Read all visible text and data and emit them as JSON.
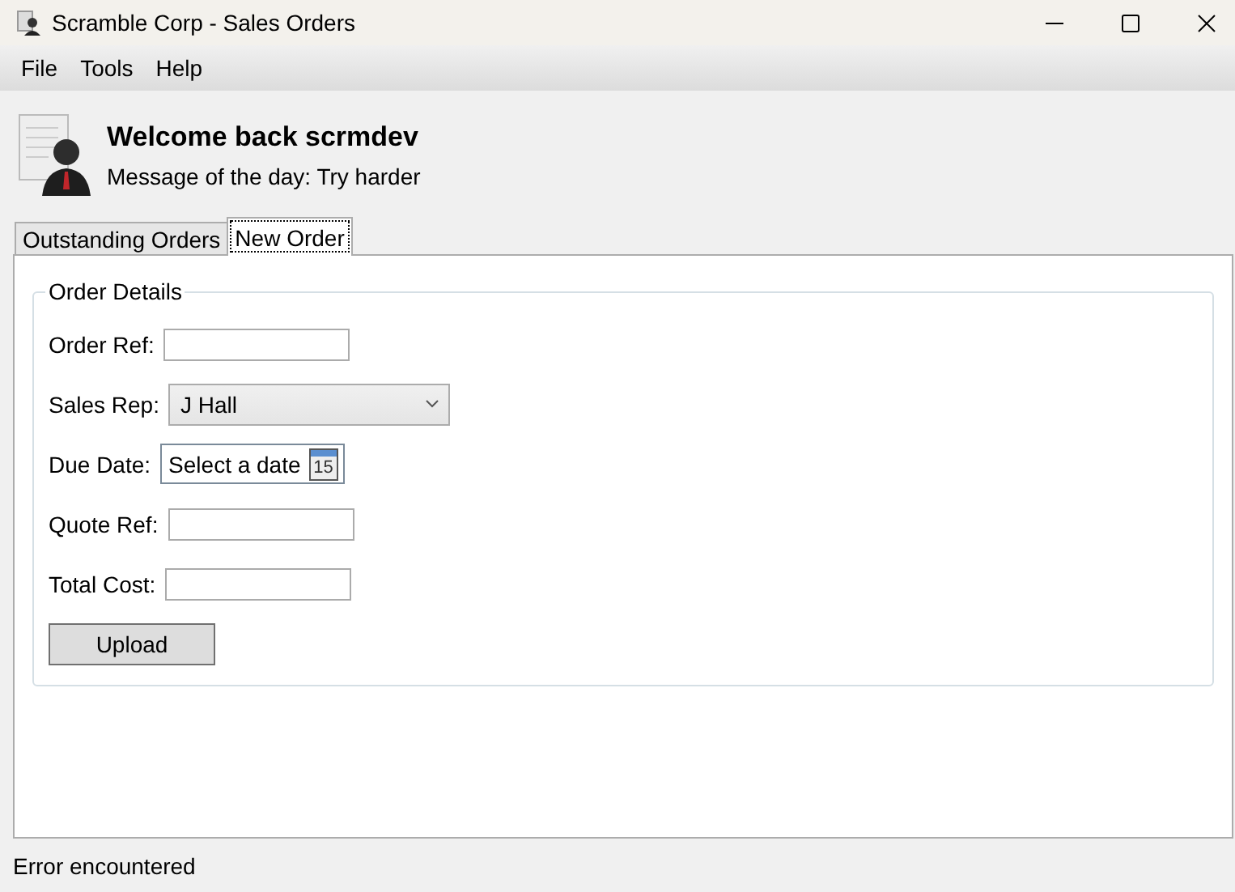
{
  "window": {
    "title": "Scramble Corp - Sales Orders"
  },
  "menu": [
    {
      "label": "File"
    },
    {
      "label": "Tools"
    },
    {
      "label": "Help"
    }
  ],
  "header": {
    "welcome": "Welcome back scrmdev",
    "message": "Message of the day: Try harder"
  },
  "tabs": [
    {
      "label": "Outstanding Orders",
      "selected": false
    },
    {
      "label": "New Order",
      "selected": true
    }
  ],
  "order_details": {
    "title": "Order Details",
    "fields": [
      {
        "kind": "text",
        "label": "Order Ref:"
      },
      {
        "kind": "combo",
        "label": "Sales Rep:",
        "value": "J Hall"
      },
      {
        "kind": "date",
        "label": "Due Date:",
        "placeholder": "Select a date",
        "calendar_day": "15"
      },
      {
        "kind": "text",
        "label": "Quote Ref:"
      },
      {
        "kind": "text",
        "label": "Total Cost:"
      }
    ],
    "button": "Upload"
  },
  "status_bar": {
    "text": "Error encountered"
  }
}
